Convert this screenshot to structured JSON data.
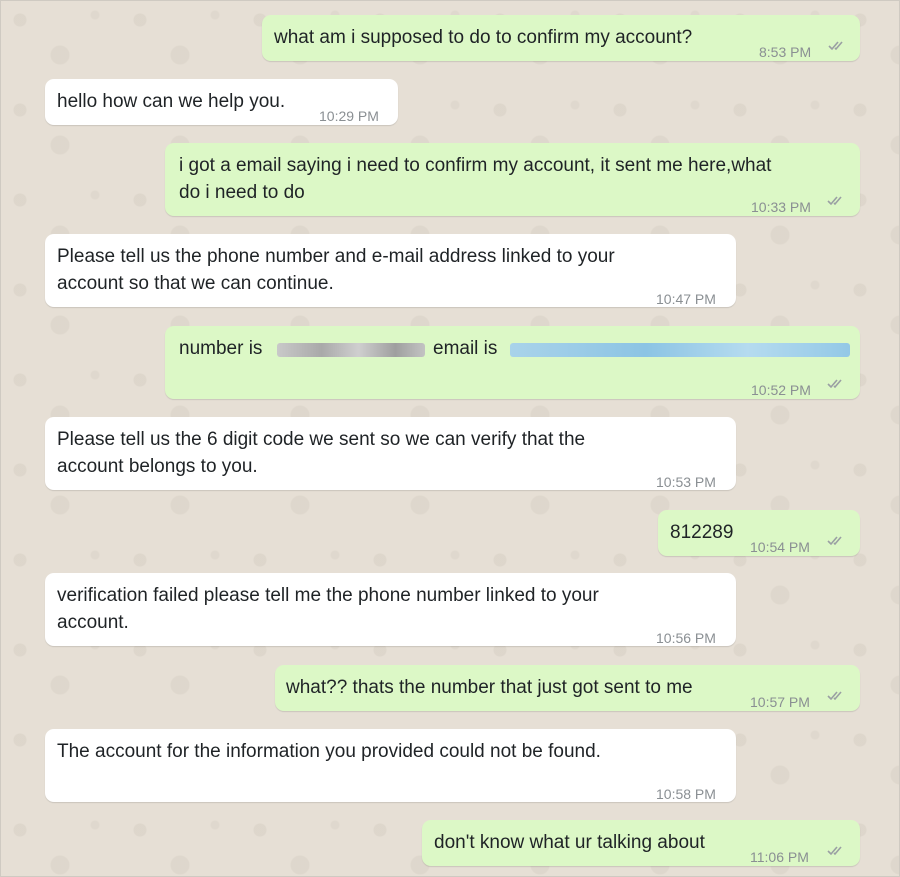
{
  "messages": [
    {
      "text": "what am i supposed to do to confirm my account?",
      "time": "8:53 PM"
    },
    {
      "text": "hello how can we help you.",
      "time": "10:29 PM"
    },
    {
      "line1": "i got a email saying i need to confirm my account, it sent me here,what",
      "line2": "do i need to do",
      "time": "10:33 PM"
    },
    {
      "line1": "Please tell us the phone number and e-mail address linked to your",
      "line2": "account so that we can continue.",
      "time": "10:47 PM"
    },
    {
      "prefix": "number is",
      "middle": "email is",
      "time": "10:52 PM"
    },
    {
      "line1": "Please tell us the 6 digit code we sent so we can verify that the",
      "line2": "account belongs to you.",
      "time": "10:53 PM"
    },
    {
      "text": "812289",
      "time": "10:54 PM"
    },
    {
      "line1": "verification failed please tell me the phone number linked to your",
      "line2": "account.",
      "time": "10:56 PM"
    },
    {
      "text": "what?? thats the number that just got sent to me",
      "time": "10:57 PM"
    },
    {
      "text": "The account for the information you provided could not be found.",
      "time": "10:58 PM"
    },
    {
      "text": "don't know what ur talking about",
      "time": "11:06 PM"
    }
  ],
  "colors": {
    "outgoing_bubble": "#dcf8c6",
    "incoming_bubble": "#ffffff",
    "chat_background": "#e6dfd5",
    "timestamp": "#8a8f93",
    "redaction_gray": "#b9b9b9",
    "redaction_blue": "#9ccbe6"
  },
  "icons": {
    "read_receipt": "double-check-icon"
  }
}
